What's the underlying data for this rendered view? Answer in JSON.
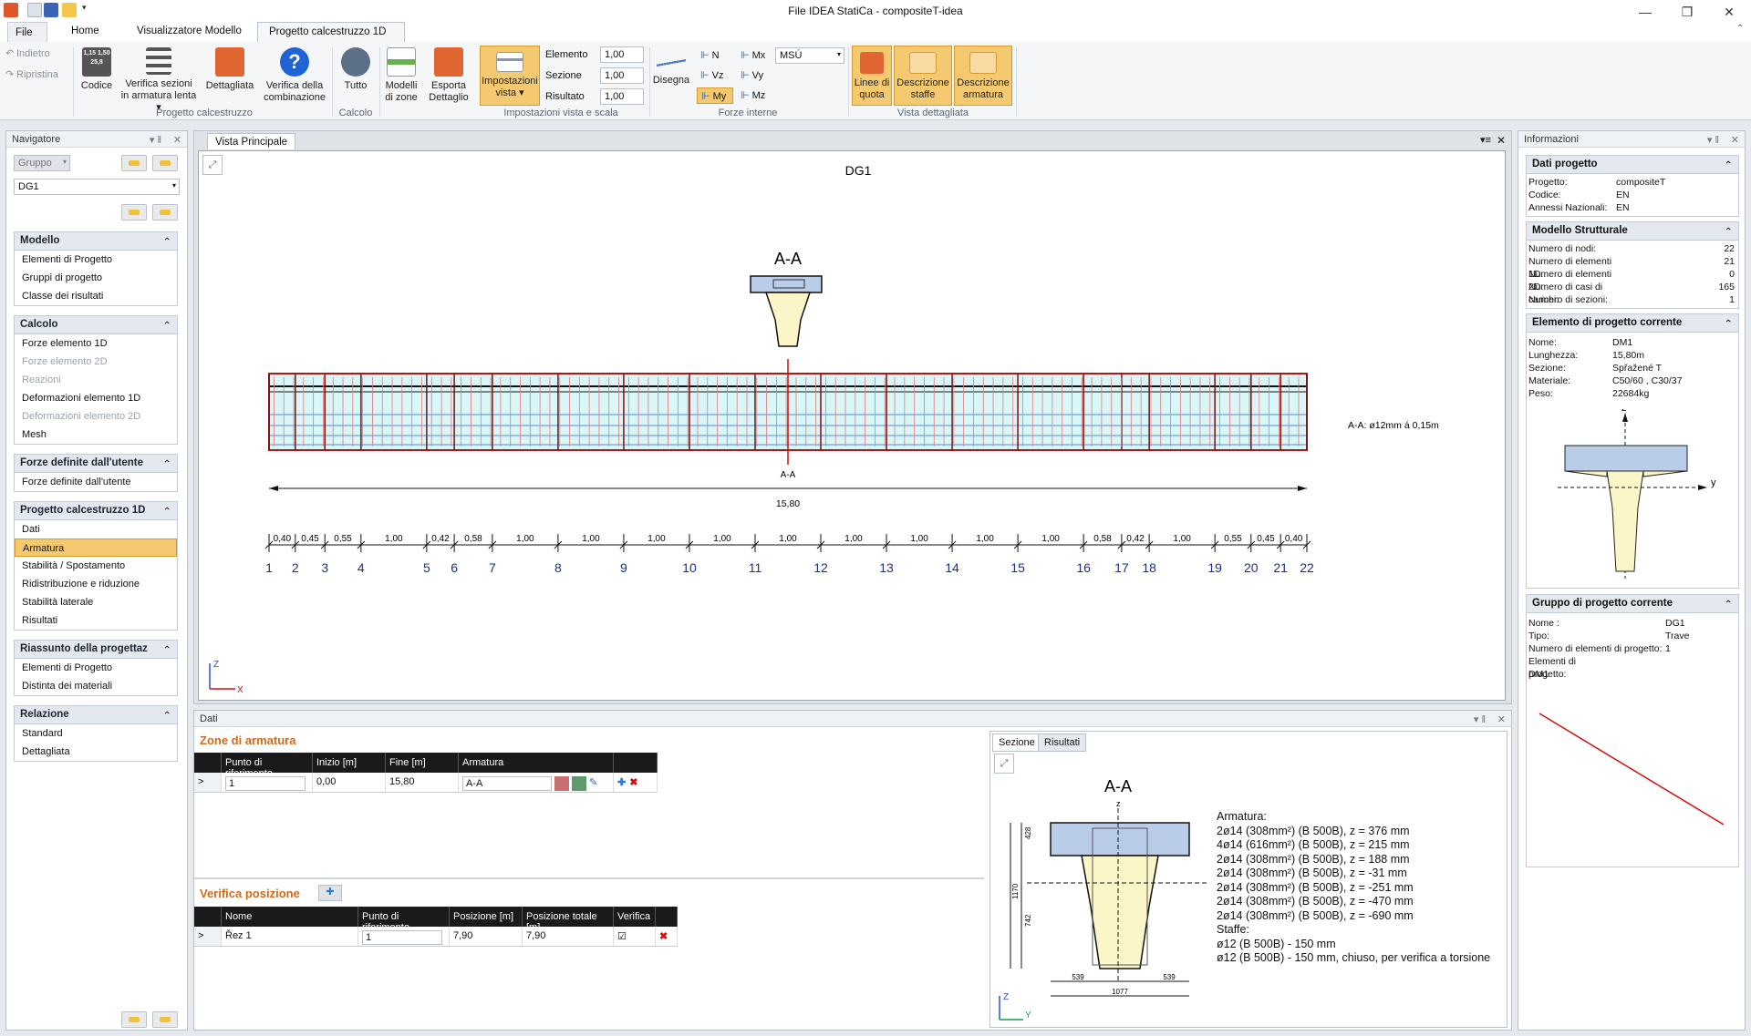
{
  "window": {
    "title": "File IDEA StatiCa - compositeT-idea",
    "min": "—",
    "max": "❐",
    "close": "✕"
  },
  "tabs": [
    {
      "label": "File"
    },
    {
      "label": "Home"
    },
    {
      "label": "Visualizzatore Modello"
    },
    {
      "label": "Progetto calcestruzzo 1D"
    }
  ],
  "ribbon": {
    "undo": "Indietro",
    "redo": "Ripristina",
    "codice": "Codice",
    "codice_icon_text": "1,15 1,50 25,8",
    "verifica_sezioni": [
      "Verifica sezioni",
      "in armatura lenta ▾"
    ],
    "dettagliata": "Dettagliata",
    "verifica_comb": [
      "Verifica della",
      "combinazione"
    ],
    "group_progetto": "Progetto calcestruzzo",
    "tutto": "Tutto",
    "group_calcolo": "Calcolo",
    "modelli": [
      "Modelli",
      "di zone"
    ],
    "esporta": [
      "Esporta",
      "Dettaglio"
    ],
    "impostazioni": [
      "Impostazioni",
      "vista ▾"
    ],
    "elemento_label": "Elemento",
    "elemento_val": "1,00",
    "sezione_label": "Sezione",
    "sezione_val": "1,00",
    "risultato_label": "Risultato",
    "risultato_val": "1,00",
    "group_imp": "Impostazioni vista e scala",
    "disegna": "Disegna",
    "forces": [
      "N",
      "Mx",
      "Vz",
      "Vy",
      "My",
      "Mz"
    ],
    "msu": "MSÚ",
    "group_forze": "Forze interne",
    "linee": [
      "Linee di",
      "quota"
    ],
    "desc_staffe": [
      "Descrizione",
      "staffe"
    ],
    "desc_armatura": [
      "Descrizione",
      "armatura"
    ],
    "group_vista": "Vista dettagliata"
  },
  "navigator": {
    "title": "Navigatore",
    "gruppo": "Gruppo",
    "dg": "DG1",
    "sections": [
      {
        "title": "Modello",
        "items": [
          {
            "t": "Elementi di Progetto",
            "s": ""
          },
          {
            "t": "Gruppi di progetto",
            "s": ""
          },
          {
            "t": "Classe dei risultati",
            "s": ""
          }
        ]
      },
      {
        "title": "Calcolo",
        "items": [
          {
            "t": "Forze elemento 1D",
            "s": ""
          },
          {
            "t": "Forze elemento 2D",
            "s": "dis"
          },
          {
            "t": "Reazioni",
            "s": "dis"
          },
          {
            "t": "Deformazioni elemento 1D",
            "s": ""
          },
          {
            "t": "Deformazioni elemento 2D",
            "s": "dis"
          },
          {
            "t": "Mesh",
            "s": ""
          }
        ]
      },
      {
        "title": "Forze definite dall'utente",
        "items": [
          {
            "t": "Forze definite dall'utente",
            "s": ""
          }
        ]
      },
      {
        "title": "Progetto calcestruzzo 1D",
        "items": [
          {
            "t": "Dati",
            "s": ""
          },
          {
            "t": "Armatura",
            "s": "sel"
          },
          {
            "t": "Stabilità / Spostamento",
            "s": ""
          },
          {
            "t": "Ridistribuzione e riduzione",
            "s": ""
          },
          {
            "t": "Stabilità laterale",
            "s": ""
          },
          {
            "t": "Risultati",
            "s": ""
          }
        ]
      },
      {
        "title": "Riassunto della progettaz",
        "items": [
          {
            "t": "Elementi di Progetto",
            "s": ""
          },
          {
            "t": "Distinta dei materiali",
            "s": ""
          }
        ]
      },
      {
        "title": "Relazione",
        "items": [
          {
            "t": "Standard",
            "s": ""
          },
          {
            "t": "Dettagliata",
            "s": ""
          }
        ]
      }
    ]
  },
  "main_view": {
    "tab": "Vista Principale",
    "title": "DG1",
    "section_label": "A-A",
    "cut_label": "A-A",
    "zone_note": "A-A: ø12mm á 0,15m",
    "total_length": "15,80",
    "segments": [
      "0,40",
      "0,45",
      "0,55",
      "1,00",
      "0,42",
      "0,58",
      "1,00",
      "1,00",
      "1,00",
      "1,00",
      "1,00",
      "1,00",
      "1,00",
      "1,00",
      "1,00",
      "0,58",
      "0,42",
      "1,00",
      "0,55",
      "0,45",
      "0,40"
    ],
    "nodes": [
      "1",
      "2",
      "3",
      "4",
      "5",
      "6",
      "7",
      "8",
      "9",
      "10",
      "11",
      "12",
      "13",
      "14",
      "15",
      "16",
      "17",
      "18",
      "19",
      "20",
      "21",
      "22"
    ],
    "axis_z": "Z",
    "axis_x": "X"
  },
  "dati": {
    "title": "Dati",
    "zone_title": "Zone di armatura",
    "zone_headers": [
      "Punto di riferimento",
      "Inizio [m]",
      "Fine [m]",
      "Armatura"
    ],
    "zone_row": {
      "ref": "1",
      "inizio": "0,00",
      "fine": "15,80",
      "arm": "A-A"
    },
    "ver_title": "Verifica posizione",
    "ver_headers": [
      "Nome",
      "Punto di riferimento",
      "Posizione [m]",
      "Posizione totale [m]",
      "Verifica"
    ],
    "ver_row": {
      "nome": "Řez 1",
      "ref": "1",
      "pos": "7,90",
      "postot": "7,90",
      "check": "☑"
    },
    "sub_tabs": [
      "Sezione",
      "Risultati"
    ],
    "section_title": "A-A",
    "arm_lines": [
      "Armatura:",
      "2ø14 (308mm²) (B 500B), z = 376 mm",
      "4ø14 (616mm²) (B 500B), z = 215 mm",
      "2ø14 (308mm²) (B 500B), z = 188 mm",
      "2ø14 (308mm²) (B 500B), z = -31 mm",
      "2ø14 (308mm²) (B 500B), z = -251 mm",
      "2ø14 (308mm²) (B 500B), z = -470 mm",
      "2ø14 (308mm²) (B 500B), z = -690 mm",
      "Staffe:",
      "ø12 (B 500B) - 150 mm",
      "ø12 (B 500B) - 150 mm, chiuso, per verifica a torsione"
    ],
    "dims": {
      "h_total": "1170",
      "h_top": "428",
      "h_bot": "742",
      "w_l": "539",
      "w_r": "539",
      "w_tot": "1077"
    },
    "axis_z": "Z",
    "axis_y": "Y"
  },
  "info": {
    "title": "Informazioni",
    "dati_progetto": {
      "title": "Dati progetto",
      "rows": [
        [
          "Progetto:",
          "compositeT"
        ],
        [
          "Codice:",
          "EN"
        ],
        [
          "Annessi Nazionali:",
          "EN"
        ]
      ]
    },
    "modello": {
      "title": "Modello Strutturale",
      "rows": [
        [
          "Numero di nodi:",
          "22"
        ],
        [
          "Numero di elementi 1D:",
          "21"
        ],
        [
          "Numero di elementi 2D:",
          "0"
        ],
        [
          "Numero di casi di carichi:",
          "165"
        ],
        [
          "Numero di sezioni:",
          "1"
        ]
      ]
    },
    "elemento": {
      "title": "Elemento di progetto corrente",
      "rows": [
        [
          "Nome:",
          "DM1"
        ],
        [
          "Lunghezza:",
          "15,80m"
        ],
        [
          "Sezione:",
          "Spřažené T"
        ],
        [
          "Materiale:",
          "C50/60      ,  C30/37"
        ],
        [
          "Peso:",
          "22684kg"
        ]
      ],
      "axis_z": "z",
      "axis_y": "y"
    },
    "gruppo": {
      "title": "Gruppo di progetto corrente",
      "rows": [
        [
          "Nome :",
          "DG1"
        ],
        [
          "Tipo:",
          "Trave"
        ],
        [
          "Numero di elementi di progetto:",
          "1"
        ],
        [
          "Elementi di progetto:",
          ""
        ],
        [
          "DM1",
          ""
        ]
      ]
    }
  }
}
